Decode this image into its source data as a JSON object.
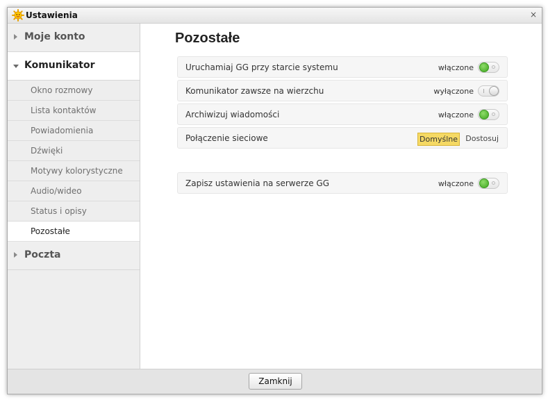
{
  "window": {
    "title": "Ustawienia",
    "close_symbol": "×",
    "app_icon": "sun-logo-icon"
  },
  "sidebar": {
    "categories": [
      {
        "label": "Moje konto",
        "expanded": false
      },
      {
        "label": "Komunikator",
        "expanded": true,
        "items": [
          {
            "label": "Okno rozmowy"
          },
          {
            "label": "Lista kontaktów"
          },
          {
            "label": "Powiadomienia"
          },
          {
            "label": "Dźwięki"
          },
          {
            "label": "Motywy kolorystyczne"
          },
          {
            "label": "Audio/wideo"
          },
          {
            "label": "Status i opisy"
          },
          {
            "label": "Pozostałe",
            "active": true
          }
        ]
      },
      {
        "label": "Poczta",
        "expanded": false
      }
    ]
  },
  "main": {
    "title": "Pozostałe",
    "settings": [
      {
        "label": "Uruchamiaj GG przy starcie systemu",
        "state": "włączone",
        "on": true
      },
      {
        "label": "Komunikator zawsze na wierzchu",
        "state": "wyłączone",
        "on": false
      },
      {
        "label": "Archiwizuj wiadomości",
        "state": "włączone",
        "on": true
      },
      {
        "label": "Połączenie sieciowe",
        "options": [
          "Domyślne",
          "Dostosuj"
        ],
        "selected": "Domyślne"
      }
    ],
    "server_setting": {
      "label": "Zapisz ustawienia na serwerze GG",
      "state": "włączone",
      "on": true
    }
  },
  "footer": {
    "close_label": "Zamknij"
  },
  "colors": {
    "toggle_on": "#3ea61f",
    "selected_option": "#f5d964"
  }
}
